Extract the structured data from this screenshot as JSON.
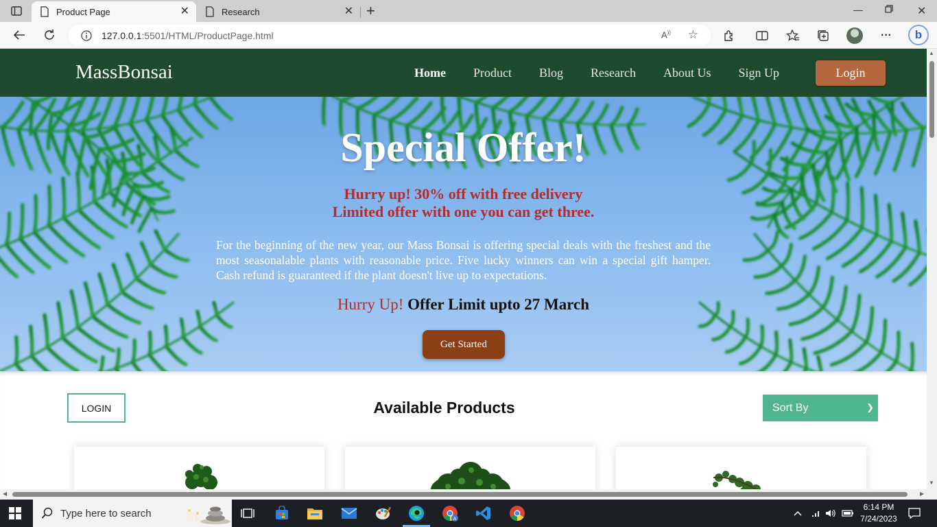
{
  "browser": {
    "tabs": [
      {
        "title": "Product Page",
        "active": true
      },
      {
        "title": "Research",
        "active": false
      }
    ],
    "url": {
      "host": "127.0.0.1",
      "path": ":5501/HTML/ProductPage.html"
    },
    "icons": [
      "sidebar-icon",
      "page-icon",
      "close-icon",
      "plus-icon",
      "minimize-icon",
      "restore-icon",
      "back-icon",
      "refresh-icon",
      "info-icon",
      "read-aloud-icon",
      "favorite-icon",
      "extensions-icon",
      "split-screen-icon",
      "favorites-icon",
      "collections-icon",
      "more-icon",
      "bing-icon"
    ],
    "read_aloud": "A",
    "bing": "b"
  },
  "site": {
    "brand": "MassBonsai",
    "nav": [
      "Home",
      "Product",
      "Blog",
      "Research",
      "About Us",
      "Sign Up"
    ],
    "login_label": "Login",
    "colors": {
      "nav_bg": "#1e4a2d",
      "login_bg": "#b5673f",
      "accent_green": "#4fb58f",
      "cta": "#8a3f17",
      "offer_red": "#b52a2a"
    }
  },
  "hero": {
    "title": "Special Offer!",
    "subtitle_1": "Hurry up! 30% off with free delivery",
    "subtitle_2": "Limited offer with one you can get three.",
    "body": "For the beginning of the new year, our Mass Bonsai is offering special deals with the freshest and the most seasonalable plants with reasonable price. Five lucky winners can win a special gift hamper. Cash refund is guaranteed if the plant doesn't live up to expectations.",
    "limit_hurry": "Hurry Up!",
    "limit_text": "Offer Limit upto 27 March",
    "cta": "Get Started"
  },
  "products": {
    "login_button": "LOGIN",
    "title": "Available Products",
    "sort_label": "Sort By"
  },
  "taskbar": {
    "search_placeholder": "Type here to search",
    "time": "6:14 PM",
    "date": "7/24/2023",
    "app_icons": [
      "task-view-icon",
      "store-icon",
      "file-explorer-icon",
      "mail-icon",
      "paint-icon",
      "edge-icon",
      "chrome-profile-icon",
      "vscode-icon",
      "chrome-icon"
    ]
  }
}
